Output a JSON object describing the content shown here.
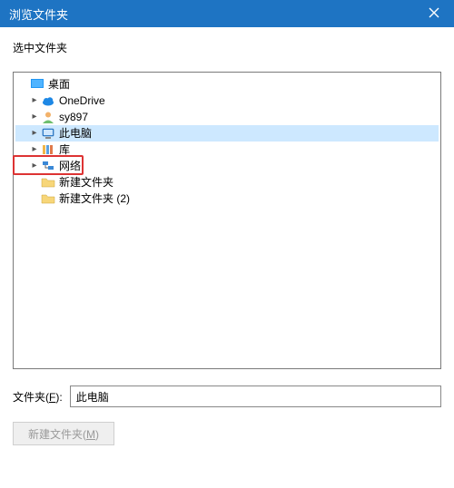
{
  "titlebar": {
    "title": "浏览文件夹"
  },
  "instruction": "选中文件夹",
  "tree": {
    "root": {
      "label": "桌面"
    },
    "items": [
      {
        "label": "OneDrive",
        "icon": "cloud",
        "expandable": true
      },
      {
        "label": "sy897",
        "icon": "user",
        "expandable": true
      },
      {
        "label": "此电脑",
        "icon": "pc",
        "expandable": true,
        "selected": true
      },
      {
        "label": "库",
        "icon": "library",
        "expandable": true
      },
      {
        "label": "网络",
        "icon": "network",
        "expandable": true,
        "highlighted": true
      },
      {
        "label": "新建文件夹",
        "icon": "folder",
        "expandable": false
      },
      {
        "label": "新建文件夹 (2)",
        "icon": "folder",
        "expandable": false
      }
    ]
  },
  "folder_field": {
    "label_prefix": "文件夹(",
    "label_key": "F",
    "label_suffix": "):",
    "value": "此电脑"
  },
  "buttons": {
    "new_folder_prefix": "新建文件夹(",
    "new_folder_key": "M",
    "new_folder_suffix": ")"
  }
}
